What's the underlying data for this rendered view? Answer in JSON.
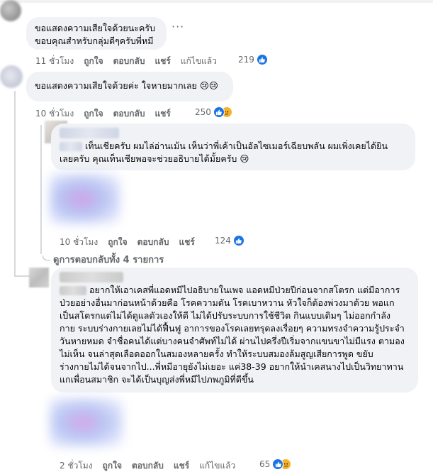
{
  "comments": [
    {
      "text_lines": [
        "ขอแสดงความเสียใจด้วยนะครับ",
        "ขอบคุณสำหรับกลุ่มดีๆครับพี่หมี"
      ],
      "time": "11 ชั่วโมง",
      "like": "ถูกใจ",
      "reply": "ตอบกลับ",
      "share": "แชร์",
      "edited": "แก้ไขแล้ว",
      "reactions": "219",
      "more": "···"
    },
    {
      "text_lines": [
        "ขอแสดงความเสียใจด้วยค่ะ ใจหายมากเลย 😢😢"
      ],
      "time": "10 ชั่วโมง",
      "like": "ถูกใจ",
      "reply": "ตอบกลับ",
      "share": "แชร์",
      "reactions": "250"
    },
    {
      "text_lines": [
        "เท็นเชียครับ ผมไล่อ่านเม้น เห็นว่าพี่เค้าเป็นอัลไซเมอร์เฉียบพลัน ผมเพิ่งเคยได้ยิน",
        "เลยครับ คุณเท็นเชียพอจะช่วยอธิบายได้มั้ยครับ 😢"
      ],
      "time": "10 ชั่วโมง",
      "like": "ถูกใจ",
      "reply": "ตอบกลับ",
      "share": "แชร์",
      "reactions": "124"
    },
    {
      "text_lines": [
        "อยากให้เอาเคสพี่แอดหมีไปอธิบายในเพจ แอดหมีป่วยปีก่อนจากสโตรก แต่มีอาการ",
        "ป่วยอย่างอื่นมาก่อนหน้าด้วยคือ โรคความดัน โรคเบาหวาน หัวใจก็ต้องพ่วงมาด้วย พอแก",
        "เป็นสโตรกแต่ไม่ได้ดูแลตัวเองให้ดี ไม่ได้ปรับระบบการใช้ชีวิต กินแบบเดิมๆ ไม่ออกกำลัง",
        "กาย ระบบร่างกายเลยไม่ได้ฟื้นฟู อาการของโรคเลยทรุดลงเรื่อยๆ ความทรงจำความรู้ประจำ",
        "วันหายหมด จำชื่อคนได้แต่บางคนจำศัพท์ไม่ได้ ผ่านไปครึ่งปีเริ่มจากแขนขาไม่มีแรง ตามอง",
        "ไม่เห็น จนล่าสุดเลือดออกในสมองหลายครั้ง ทำให้ระบบสมองล้มสูญเสียการพูด ขยับ",
        "ร่างกายไม่ได้จนจากไป...พี่หมีอายุยังไม่เยอะ แค่38-39 อยากให้นำเคสนางไปเป็นวิทยาทาน",
        "แกเพื่อนสมาชิก จะได้เป็นบุญส่งพี่หมีไปภพภูมิที่ดีขึ้น"
      ],
      "time": "2 ชั่วโมง",
      "like": "ถูกใจ",
      "reply": "ตอบกลับ",
      "share": "แชร์",
      "edited": "แก้ไขแล้ว",
      "reactions": "65"
    }
  ],
  "view_replies": "ดูการตอบกลับทั้ง 4 รายการ",
  "icons": {
    "like": "like-reaction-icon",
    "sad": "sad-reaction-icon",
    "more": "more-options-icon"
  },
  "colors": {
    "bubble_bg": "#f0f2f5",
    "meta_text": "#65676b",
    "like_blue": "#1b74e4",
    "sad_yellow": "#f7b125"
  }
}
